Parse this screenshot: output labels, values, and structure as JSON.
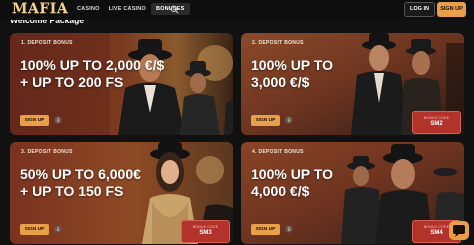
{
  "header": {
    "logo_text": "MAFIA",
    "nav": [
      {
        "label": "CASINO"
      },
      {
        "label": "LIVE CASINO"
      },
      {
        "label": "BONUSES"
      }
    ],
    "login_label": "LOG IN",
    "signup_label": "SIGN UP"
  },
  "heading": "Welcome Package",
  "cards": [
    {
      "label": "1. DEPOSIT BONUS",
      "title_line1": "100% UP TO 2,000 €/$",
      "title_line2": "+ UP TO 200 FS",
      "button": "SIGN UP",
      "promo_label": "",
      "promo_code": ""
    },
    {
      "label": "2. DEPOSIT BONUS",
      "title_line1": "100% UP TO",
      "title_line2": "3,000 €/$",
      "button": "SIGN UP",
      "promo_label": "BONUS CODE",
      "promo_code": "SM2"
    },
    {
      "label": "3. DEPOSIT BONUS",
      "title_line1": "50% UP TO 6,000€",
      "title_line2": "+ UP TO 150 FS",
      "button": "SIGN UP",
      "promo_label": "BONUS CODE",
      "promo_code": "SM3"
    },
    {
      "label": "4. DEPOSIT BONUS",
      "title_line1": "100% UP TO",
      "title_line2": "4,000 €/$",
      "button": "SIGN UP",
      "promo_label": "BONUS CODE",
      "promo_code": "SM4"
    }
  ],
  "colors": {
    "accent": "#e7a048",
    "promo": "#b3322a",
    "background": "#111111"
  },
  "icons": [
    "search-icon",
    "info-icon",
    "chat-icon"
  ]
}
